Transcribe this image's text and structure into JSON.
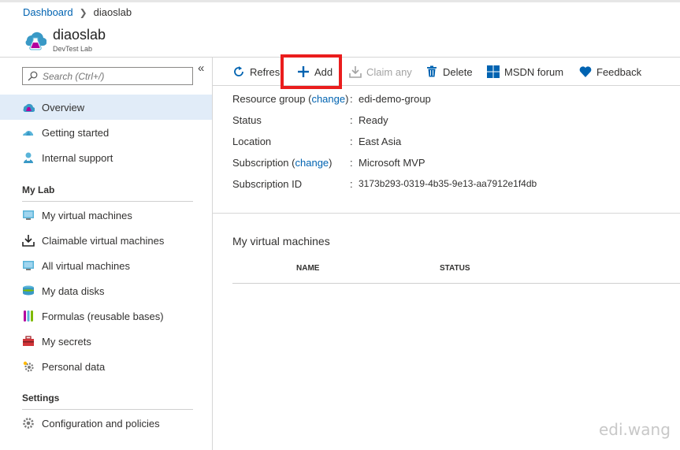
{
  "breadcrumb": {
    "root": "Dashboard",
    "current": "diaoslab"
  },
  "header": {
    "title": "diaoslab",
    "subtitle": "DevTest Lab"
  },
  "search": {
    "placeholder": "Search (Ctrl+/)"
  },
  "sidebar": {
    "top_items": [
      {
        "label": "Overview",
        "icon": "overview-icon"
      },
      {
        "label": "Getting started",
        "icon": "cloud-icon"
      },
      {
        "label": "Internal support",
        "icon": "support-icon"
      }
    ],
    "my_lab_title": "My Lab",
    "my_lab_items": [
      {
        "label": "My virtual machines",
        "icon": "vm-icon"
      },
      {
        "label": "Claimable virtual machines",
        "icon": "download-icon"
      },
      {
        "label": "All virtual machines",
        "icon": "vm-icon"
      },
      {
        "label": "My data disks",
        "icon": "disk-icon"
      },
      {
        "label": "Formulas (reusable bases)",
        "icon": "formula-icon"
      },
      {
        "label": "My secrets",
        "icon": "briefcase-icon"
      },
      {
        "label": "Personal data",
        "icon": "gear-icon"
      }
    ],
    "settings_title": "Settings",
    "settings_items": [
      {
        "label": "Configuration and policies",
        "icon": "gear-icon"
      }
    ]
  },
  "toolbar": {
    "refresh": "Refresh",
    "add": "Add",
    "claim_any": "Claim any",
    "delete": "Delete",
    "msdn": "MSDN forum",
    "feedback": "Feedback"
  },
  "properties": {
    "resource_group_key": "Resource group",
    "change": "change",
    "resource_group_value": "edi-demo-group",
    "status_key": "Status",
    "status_value": "Ready",
    "location_key": "Location",
    "location_value": "East Asia",
    "subscription_key": "Subscription",
    "subscription_value": "Microsoft MVP",
    "subscription_id_key": "Subscription ID",
    "subscription_id_value": "3173b293-0319-4b35-9e13-aa7912e1f4db"
  },
  "vm_section": {
    "title": "My virtual machines",
    "col_name": "NAME",
    "col_status": "STATUS"
  },
  "watermark": "edi.wang",
  "colors": {
    "accent": "#0063b1",
    "highlight": "#ea1d1d",
    "active_bg": "#e1ecf8"
  }
}
